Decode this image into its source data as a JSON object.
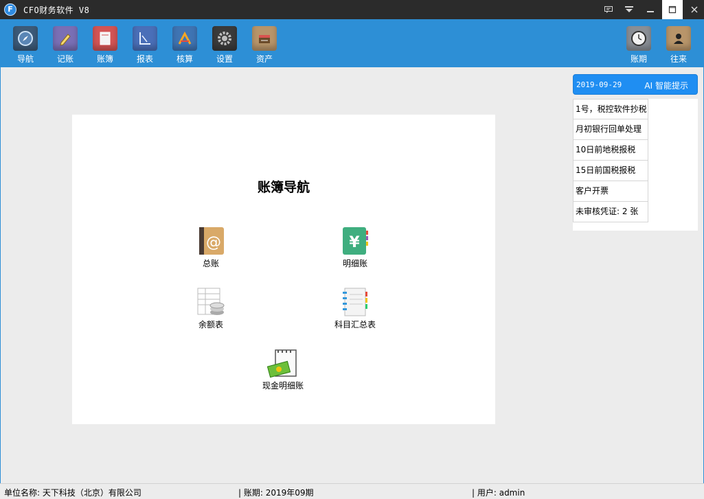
{
  "window": {
    "logo": "F",
    "title": "CFO财务软件 V8",
    "controls": [
      "message-icon",
      "dropdown-icon",
      "minimize-icon",
      "maximize-icon",
      "close-icon"
    ]
  },
  "toolbar": {
    "items": [
      {
        "label": "导航",
        "icon": "compass-icon",
        "color": "#3c5a78"
      },
      {
        "label": "记账",
        "icon": "pencil-icon",
        "color": "#7a6fb5"
      },
      {
        "label": "账簿",
        "icon": "book-icon",
        "color": "#d35454"
      },
      {
        "label": "报表",
        "icon": "report-icon",
        "color": "#4a6fb8"
      },
      {
        "label": "核算",
        "icon": "tools-icon",
        "color": "#3f74b3"
      },
      {
        "label": "设置",
        "icon": "gear-icon",
        "color": "#3a3a3a"
      },
      {
        "label": "资产",
        "icon": "asset-icon",
        "color": "#b8956a"
      }
    ],
    "right_items": [
      {
        "label": "账期",
        "icon": "clock-icon",
        "color": "#8a8f96"
      },
      {
        "label": "往来",
        "icon": "contact-icon",
        "color": "#b8956a"
      }
    ]
  },
  "navigation": {
    "title": "账簿导航",
    "items": [
      {
        "label": "总账",
        "icon": "address-book-icon"
      },
      {
        "label": "明细账",
        "icon": "yen-book-icon"
      },
      {
        "label": "余额表",
        "icon": "balance-sheet-icon"
      },
      {
        "label": "科目汇总表",
        "icon": "notebook-icon"
      },
      {
        "label": "现金明细账",
        "icon": "cash-notepad-icon"
      }
    ]
  },
  "tips": {
    "date": "2019-09-29",
    "title": "AI 智能提示",
    "items": [
      "1号，税控软件抄税",
      "月初银行回单处理",
      "10日前地税报税",
      "15日前国税报税",
      "客户开票",
      "未审核凭证: 2 张"
    ]
  },
  "status": {
    "company": "单位名称: 天下科技（北京）有限公司",
    "period": "| 账期: 2019年09期",
    "user": "| 用户: admin"
  }
}
